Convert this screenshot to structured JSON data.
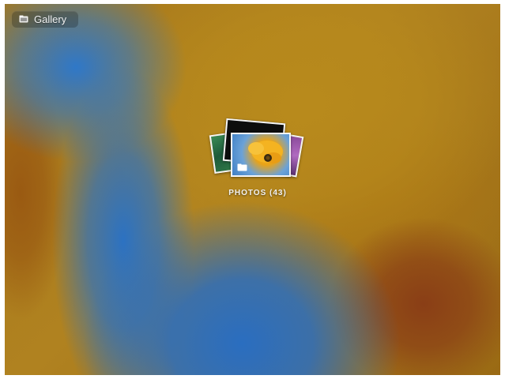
{
  "app": {
    "title": "Gallery",
    "icon": "gallery-icon"
  },
  "albums": [
    {
      "label": "PHOTOS (43)",
      "name": "PHOTOS",
      "count": 43,
      "icon": "folder-icon"
    }
  ],
  "colors": {
    "label_text": "#f3f3f3",
    "card_border": "#f4f4f4"
  }
}
